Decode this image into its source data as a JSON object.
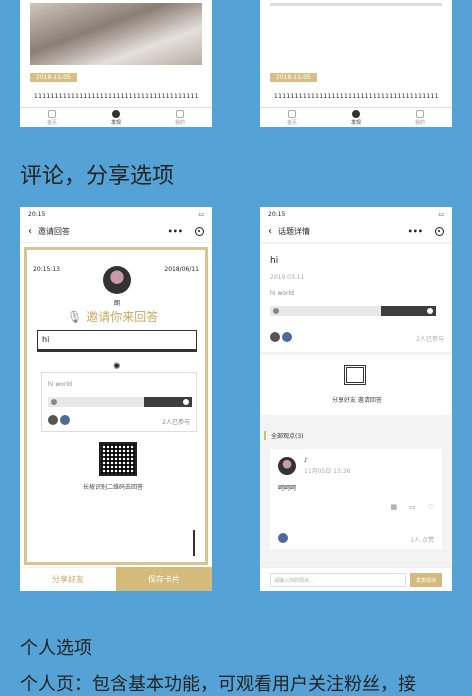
{
  "top_cards": [
    {
      "date": "2018-11-05",
      "text": "1111111111111111111111111111111111111111",
      "tabs": [
        "首页",
        "发现",
        "我的"
      ]
    },
    {
      "date": "2018-11-05",
      "text": "1111111111111111111111111111111111111111",
      "tabs": [
        "首页",
        "发现",
        "我的"
      ]
    }
  ],
  "section_title_1": "评论，分享选项",
  "invite_screen": {
    "status_time": "20:15",
    "status_signal": "all",
    "nav_title": "邀请回答",
    "nav_more": "•••",
    "card_date_left": "20:15:13",
    "card_date_right": "2018/06/11",
    "name": "朗",
    "invite_text": "邀请你来回答",
    "question": "hi",
    "answer_text": "hi world",
    "support_text": "2人已参与",
    "qr_hint": "长按识别二维码去回答",
    "btn_share": "分享好友",
    "btn_save": "保存卡片"
  },
  "detail_screen": {
    "status_time": "20:15",
    "nav_title": "话题详情",
    "nav_more": "•••",
    "title": "hi",
    "date": "2019.03.11",
    "answer_text": "hi world",
    "support_text": "2人已参与",
    "share_label": "分享好友 邀请回答",
    "all_views": "全部观点(3)",
    "comment_user": "♪",
    "comment_date": "11月05日 13:36",
    "comment_text": "呵呵呵",
    "likes_text": "1人 点赞",
    "input_placeholder": "请输入你的观点...",
    "send_label": "发表观点"
  },
  "section_title_2": "个人选项",
  "section_text_2": "个人页：包含基本功能，可观看用户关注粉丝，接"
}
